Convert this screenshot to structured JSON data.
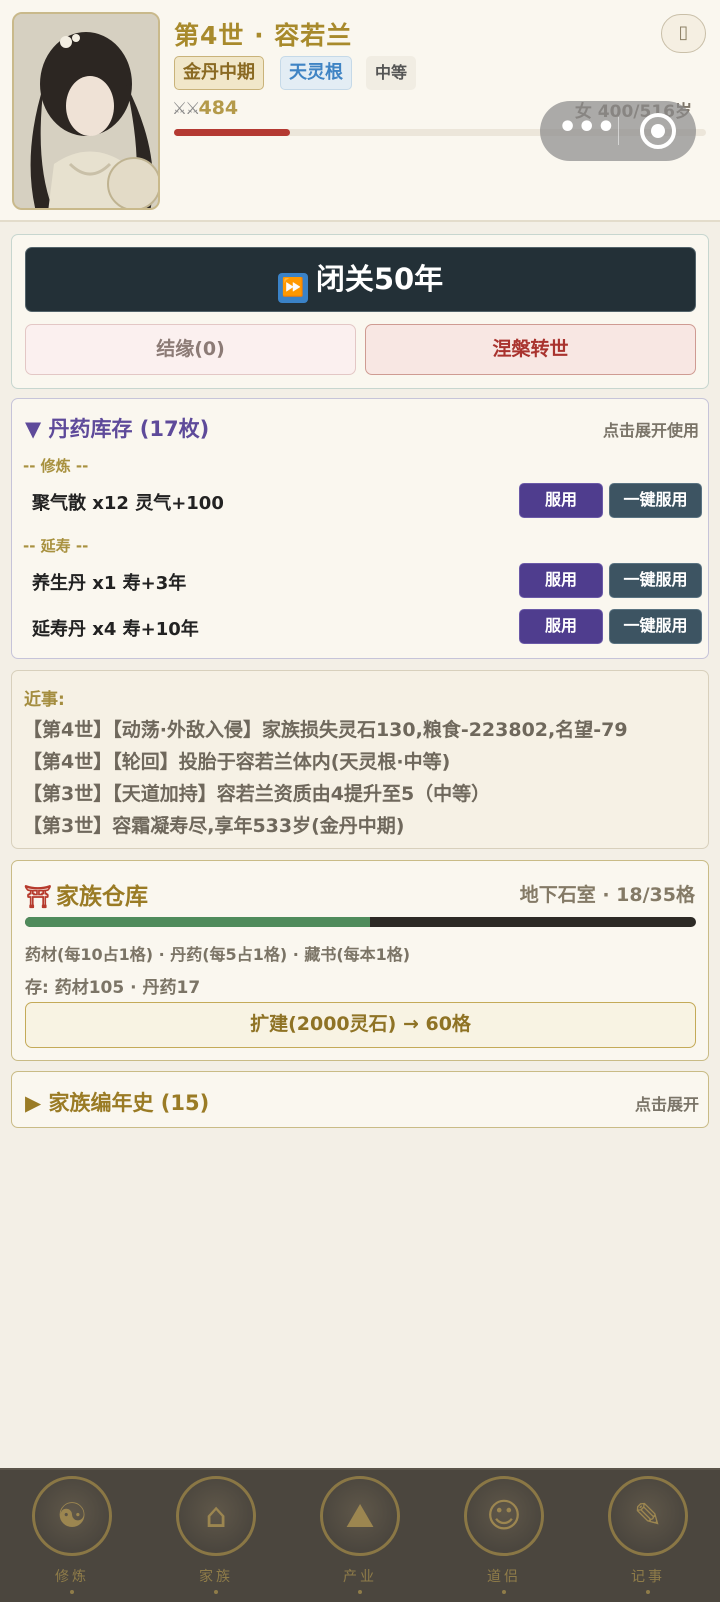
{
  "header": {
    "generation_title": "第4世 · 容若兰",
    "realm": "金丹中期",
    "spirit_root": "天灵根",
    "grade": "中等",
    "power": "484",
    "age_text": "女 400/516岁",
    "life_progress": 0.218
  },
  "actions": {
    "seclusion_label": "闭关50年",
    "bond_label": "结缘(0)",
    "rebirth_label": "涅槃转世"
  },
  "pills": {
    "title": "▼ 丹药库存 (17枚)",
    "hint": "点击展开使用",
    "category_cultivation": "-- 修炼 --",
    "category_longevity": "-- 延寿 --",
    "use_label": "服用",
    "use_all_label": "一键服用",
    "items": [
      {
        "name": "聚气散 x12  灵气+100"
      },
      {
        "name": "养生丹 x1  寿+3年"
      },
      {
        "name": "延寿丹 x4  寿+10年"
      }
    ]
  },
  "news": {
    "title": "近事:",
    "lines": [
      "【第4世】【动荡·外敌入侵】家族损失灵石130,粮食-223802,名望-79",
      "【第4世】【轮回】投胎于容若兰体内(天灵根·中等)",
      "【第3世】【天道加持】容若兰资质由4提升至5（中等）",
      "【第3世】容霜凝寿尽,享年533岁(金丹中期)"
    ]
  },
  "warehouse": {
    "title": "家族仓库",
    "capacity": "地下石室 · 18/35格",
    "fill_fraction": 0.514,
    "rule": "药材(每10占1格) · 丹药(每5占1格) · 藏书(每本1格)",
    "stored": "存: 药材105 · 丹药17",
    "expand_label": "扩建(2000灵石) → 60格"
  },
  "chronicle": {
    "title": "▶ 家族编年史 (15)",
    "hint": "点击展开"
  },
  "nav": [
    {
      "label": "修炼",
      "glyph": "☯"
    },
    {
      "label": "家族",
      "glyph": "⌂"
    },
    {
      "label": "产业",
      "glyph": "⛰"
    },
    {
      "label": "道侣",
      "glyph": "☺"
    },
    {
      "label": "记事",
      "glyph": "✎"
    }
  ],
  "colors": {
    "seclusion_bg": "#233037",
    "pill_title": "#5e4a9a",
    "rebirth_text": "#a9332e",
    "warehouse_fill": "#4f8b5b",
    "life_bar": "#b43a32"
  }
}
